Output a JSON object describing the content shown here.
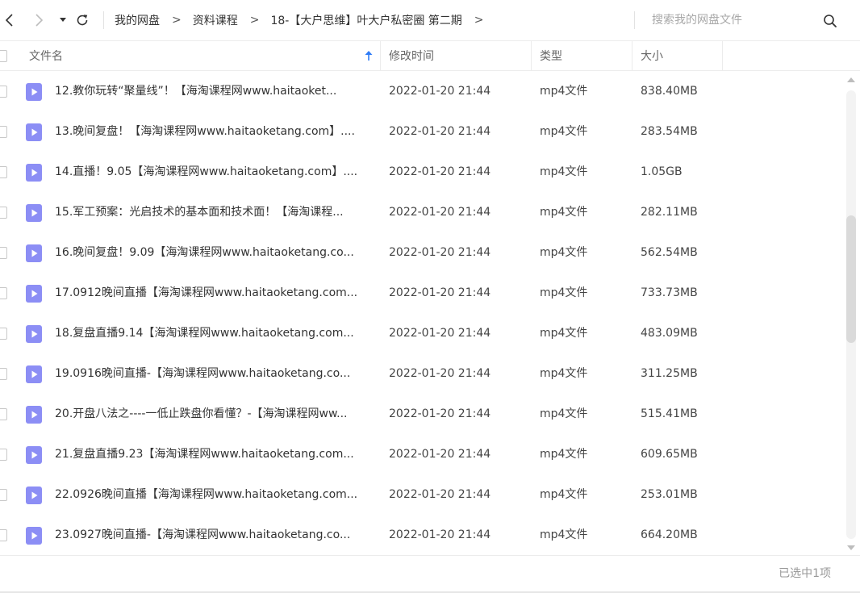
{
  "toolbar": {
    "breadcrumb": [
      "我的网盘",
      "资料课程",
      "18-【大户思维】叶大户私密圈 第二期"
    ],
    "breadcrumb_separator": ">",
    "search_placeholder": "搜索我的网盘文件"
  },
  "columns": {
    "name": "文件名",
    "modified": "修改时间",
    "type": "类型",
    "size": "大小"
  },
  "files": [
    {
      "name": "12.教你玩转“聚量线”！【海淘课程网www.haitaoket...",
      "modified": "2022-01-20 21:44",
      "type": "mp4文件",
      "size": "838.40MB"
    },
    {
      "name": "13.晚间复盘！【海淘课程网www.haitaoketang.com】....",
      "modified": "2022-01-20 21:44",
      "type": "mp4文件",
      "size": "283.54MB"
    },
    {
      "name": "14.直播！9.05【海淘课程网www.haitaoketang.com】....",
      "modified": "2022-01-20 21:44",
      "type": "mp4文件",
      "size": "1.05GB"
    },
    {
      "name": "15.军工预案：光启技术的基本面和技术面！【海淘课程...",
      "modified": "2022-01-20 21:44",
      "type": "mp4文件",
      "size": "282.11MB"
    },
    {
      "name": "16.晚间复盘！9.09【海淘课程网www.haitaoketang.co...",
      "modified": "2022-01-20 21:44",
      "type": "mp4文件",
      "size": "562.54MB"
    },
    {
      "name": "17.0912晚间直播【海淘课程网www.haitaoketang.com...",
      "modified": "2022-01-20 21:44",
      "type": "mp4文件",
      "size": "733.73MB"
    },
    {
      "name": "18.复盘直播9.14【海淘课程网www.haitaoketang.com...",
      "modified": "2022-01-20 21:44",
      "type": "mp4文件",
      "size": "483.09MB"
    },
    {
      "name": "19.0916晚间直播-【海淘课程网www.haitaoketang.co...",
      "modified": "2022-01-20 21:44",
      "type": "mp4文件",
      "size": "311.25MB"
    },
    {
      "name": "20.开盘八法之----一低止跌盘你看懂？-【海淘课程网ww...",
      "modified": "2022-01-20 21:44",
      "type": "mp4文件",
      "size": "515.41MB"
    },
    {
      "name": "21.复盘直播9.23【海淘课程网www.haitaoketang.com...",
      "modified": "2022-01-20 21:44",
      "type": "mp4文件",
      "size": "609.65MB"
    },
    {
      "name": "22.0926晚间直播【海淘课程网www.haitaoketang.com...",
      "modified": "2022-01-20 21:44",
      "type": "mp4文件",
      "size": "253.01MB"
    },
    {
      "name": "23.0927晚间直播-【海淘课程网www.haitaoketang.co...",
      "modified": "2022-01-20 21:44",
      "type": "mp4文件",
      "size": "664.20MB"
    }
  ],
  "footer": {
    "status": "已选中1项"
  },
  "colors": {
    "accent": "#2f7cf6",
    "file_icon": "#8c8ef5",
    "text": "#333333",
    "muted": "#999999"
  },
  "icons": {
    "back": "chevron-left-icon",
    "forward": "chevron-right-icon",
    "dropdown": "caret-down-icon",
    "refresh": "refresh-icon",
    "search": "search-icon",
    "sort": "sort-ascending-icon",
    "file": "video-file-icon"
  }
}
